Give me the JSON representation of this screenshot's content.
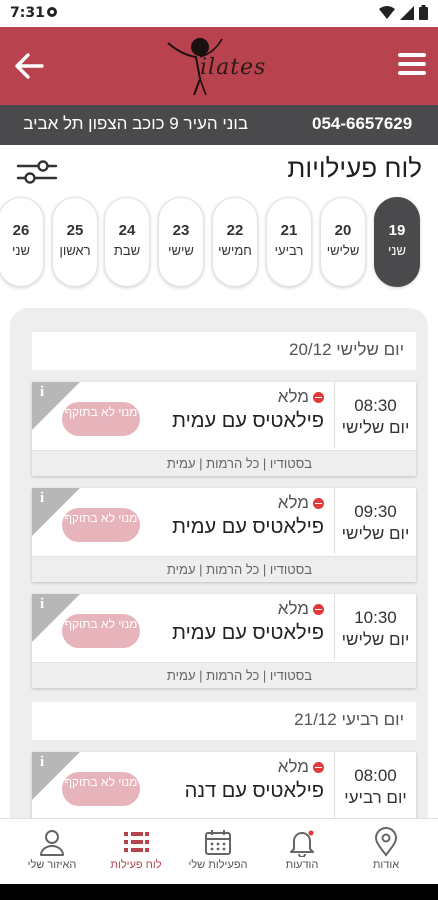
{
  "status_bar": {
    "time": "7:31"
  },
  "header": {
    "logo_text": "ilates"
  },
  "info_bar": {
    "phone": "054-6657629",
    "address": "בוני העיר 9 כוכב הצפון תל אביב"
  },
  "page": {
    "title": "לוח פעילויות"
  },
  "days": [
    {
      "num": "19",
      "name": "שני",
      "active": true
    },
    {
      "num": "20",
      "name": "שלישי"
    },
    {
      "num": "21",
      "name": "רביעי"
    },
    {
      "num": "22",
      "name": "חמישי"
    },
    {
      "num": "23",
      "name": "שישי"
    },
    {
      "num": "24",
      "name": "שבת"
    },
    {
      "num": "25",
      "name": "ראשון"
    },
    {
      "num": "26",
      "name": "שני"
    }
  ],
  "groups": [
    {
      "header": "יום שלישי 20/12"
    },
    {
      "header": "יום רביעי 21/12"
    }
  ],
  "classes": [
    {
      "time": "08:30",
      "day": "יום שלישי",
      "status": "מלא",
      "name": "פילאטיס עם עמית",
      "pill": "מנוי לא בתוקף",
      "details": "בסטודיו | כל הרמות | עמית",
      "info": "i"
    },
    {
      "time": "09:30",
      "day": "יום שלישי",
      "status": "מלא",
      "name": "פילאטיס עם עמית",
      "pill": "מנוי לא בתוקף",
      "details": "בסטודיו | כל הרמות | עמית",
      "info": "i"
    },
    {
      "time": "10:30",
      "day": "יום שלישי",
      "status": "מלא",
      "name": "פילאטיס עם עמית",
      "pill": "מנוי לא בתוקף",
      "details": "בסטודיו | כל הרמות | עמית",
      "info": "i"
    },
    {
      "time": "08:00",
      "day": "יום רביעי",
      "status": "מלא",
      "name": "פילאטיס עם דנה",
      "pill": "מנוי לא בתוקף",
      "details": "",
      "info": "i"
    }
  ],
  "tabs": [
    {
      "label": "אודות",
      "icon": "location-pin-icon"
    },
    {
      "label": "הודעות",
      "icon": "bell-icon"
    },
    {
      "label": "הפעילות שלי",
      "icon": "calendar-icon"
    },
    {
      "label": "לוח פעילות",
      "icon": "schedule-list-icon",
      "active": true
    },
    {
      "label": "האיזור שלי",
      "icon": "user-icon"
    }
  ],
  "colors": {
    "brand": "#b8424e",
    "dark": "#4a4a4c",
    "pill": "#e8b4bb",
    "full": "#e03a3a"
  }
}
